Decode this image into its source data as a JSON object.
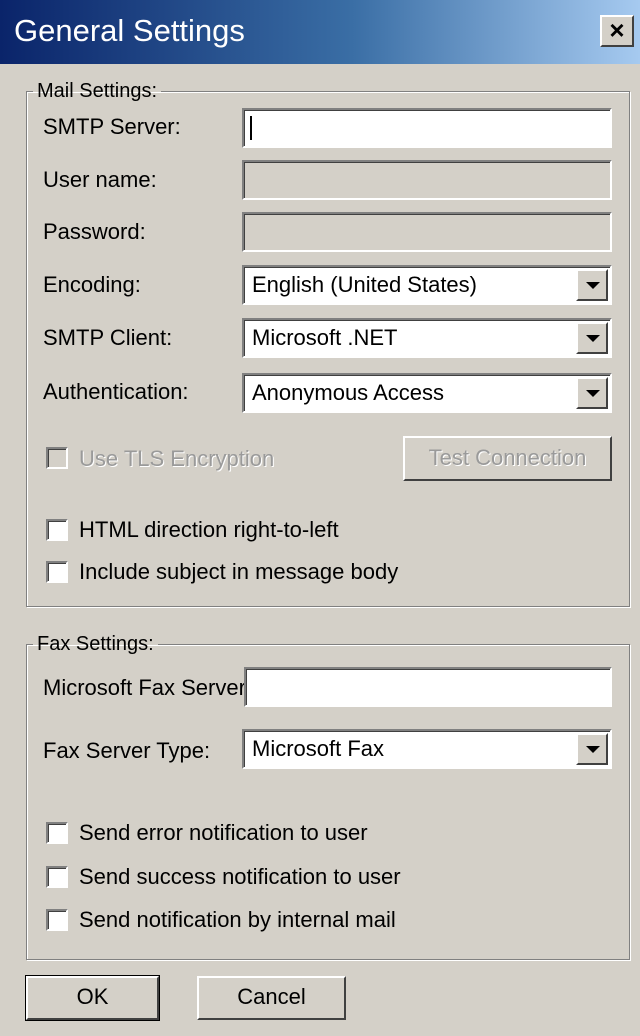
{
  "window": {
    "title": "General Settings",
    "close_label": "×"
  },
  "mail": {
    "legend": "Mail Settings:",
    "smtp_server": {
      "label": "SMTP Server:",
      "value": ""
    },
    "user_name": {
      "label": "User name:",
      "value": ""
    },
    "password": {
      "label": "Password:",
      "value": ""
    },
    "encoding": {
      "label": "Encoding:",
      "value": "English (United States)"
    },
    "smtp_client": {
      "label": "SMTP Client:",
      "value": "Microsoft .NET"
    },
    "authentication": {
      "label": "Authentication:",
      "value": "Anonymous Access"
    },
    "use_tls": {
      "label": "Use TLS Encryption",
      "checked": false,
      "enabled": false
    },
    "test_connection": {
      "label": "Test Connection",
      "enabled": false
    },
    "html_rtl": {
      "label": "HTML direction right-to-left",
      "checked": false
    },
    "include_subject": {
      "label": "Include subject in message body",
      "checked": false
    }
  },
  "fax": {
    "legend": "Fax Settings:",
    "server": {
      "label": "Microsoft Fax Server:",
      "value": ""
    },
    "server_type": {
      "label": "Fax Server Type:",
      "value": "Microsoft Fax"
    },
    "send_error": {
      "label": "Send error notification to user",
      "checked": false
    },
    "send_success": {
      "label": "Send success notification to user",
      "checked": false
    },
    "send_internal": {
      "label": "Send notification by internal mail",
      "checked": false
    }
  },
  "buttons": {
    "ok": "OK",
    "cancel": "Cancel"
  }
}
